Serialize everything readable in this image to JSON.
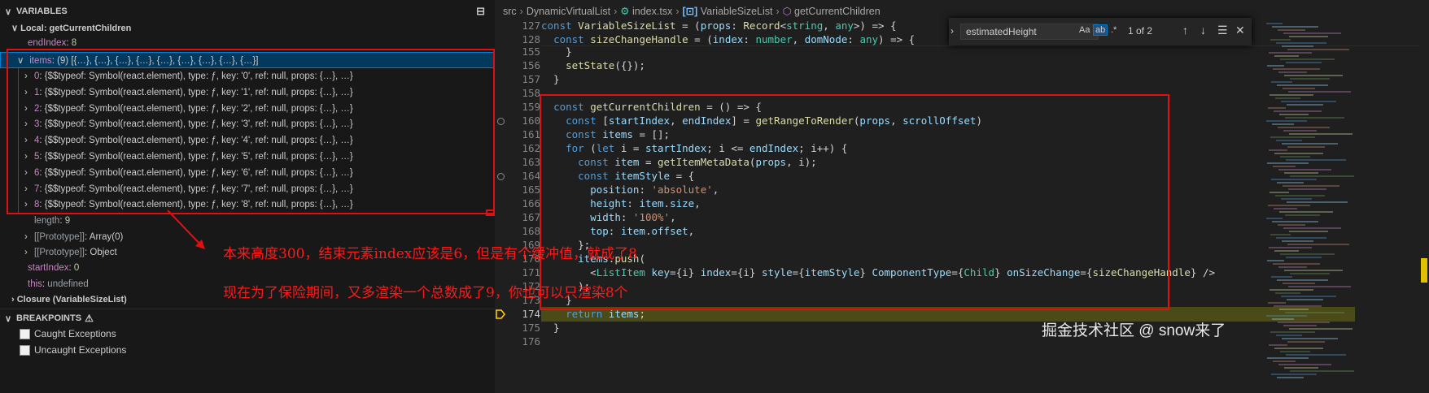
{
  "variables": {
    "header": "VARIABLES",
    "local_scope": "Local: getCurrentChildren",
    "end_index": {
      "name": "endIndex",
      "value": "8"
    },
    "items": {
      "name": "items",
      "summary": "(9) [{…}, {…}, {…}, {…}, {…}, {…}, {…}, {…}, {…}]",
      "children": [
        {
          "key": "0",
          "value": "{$$typeof: Symbol(react.element), type: ƒ, key: '0', ref: null, props: {…}, …}"
        },
        {
          "key": "1",
          "value": "{$$typeof: Symbol(react.element), type: ƒ, key: '1', ref: null, props: {…}, …}"
        },
        {
          "key": "2",
          "value": "{$$typeof: Symbol(react.element), type: ƒ, key: '2', ref: null, props: {…}, …}"
        },
        {
          "key": "3",
          "value": "{$$typeof: Symbol(react.element), type: ƒ, key: '3', ref: null, props: {…}, …}"
        },
        {
          "key": "4",
          "value": "{$$typeof: Symbol(react.element), type: ƒ, key: '4', ref: null, props: {…}, …}"
        },
        {
          "key": "5",
          "value": "{$$typeof: Symbol(react.element), type: ƒ, key: '5', ref: null, props: {…}, …}"
        },
        {
          "key": "6",
          "value": "{$$typeof: Symbol(react.element), type: ƒ, key: '6', ref: null, props: {…}, …}"
        },
        {
          "key": "7",
          "value": "{$$typeof: Symbol(react.element), type: ƒ, key: '7', ref: null, props: {…}, …}"
        },
        {
          "key": "8",
          "value": "{$$typeof: Symbol(react.element), type: ƒ, key: '8', ref: null, props: {…}, …}"
        }
      ],
      "length": {
        "name": "length",
        "value": "9"
      },
      "prototype1": {
        "name": "[[Prototype]]",
        "value": "Array(0)"
      },
      "prototype2": {
        "name": "[[Prototype]]",
        "value": "Object"
      }
    },
    "start_index": {
      "name": "startIndex",
      "value": "0"
    },
    "this_var": {
      "name": "this",
      "value": "undefined"
    },
    "closure_scope": "Closure (VariableSizeList)"
  },
  "breakpoints": {
    "header": "BREAKPOINTS",
    "warning_icon": "warning-icon",
    "items": [
      "Caught Exceptions",
      "Uncaught Exceptions"
    ]
  },
  "annotations": {
    "line1": "本来高度300，结束元素index应该是6，但是有个缓冲值，就成了8",
    "line2": "现在为了保险期间，又多渲染一个总数成了9，你也可以只渲染8个",
    "accent": "#e01010"
  },
  "breadcrumb": {
    "folder1": "src",
    "folder2": "DynamicVirtualList",
    "file": "index.tsx",
    "symbol1": "VariableSizeList",
    "symbol2": "getCurrentChildren"
  },
  "find": {
    "query": "estimatedHeight",
    "opt_case": "Aa",
    "opt_word": "ab",
    "opt_regex": ".*",
    "count": "1 of 2"
  },
  "line_numbers": [
    "127",
    "128",
    "155",
    "156",
    "157",
    "158",
    "159",
    "160",
    "161",
    "162",
    "163",
    "164",
    "165",
    "166",
    "167",
    "168",
    "169",
    "170",
    "171",
    "172",
    "173",
    "174",
    "175",
    "176"
  ],
  "code_lines": [
    "const VariableSizeList = (props: Record<string, any>) => {",
    "  const sizeChangeHandle = (index: number, domNode: any) => {",
    "    }",
    "    setState({});",
    "  }",
    "",
    "  const getCurrentChildren = () => {",
    "    const [startIndex, endIndex] = getRangeToRender(props, scrollOffset)",
    "    const items = [];",
    "    for (let i = startIndex; i <= endIndex; i++) {",
    "      const item = getItemMetaData(props, i);",
    "      const itemStyle = {",
    "        position: 'absolute',",
    "        height: item.size,",
    "        width: '100%',",
    "        top: item.offset,",
    "      };",
    "      items.push(",
    "        <ListItem key={i} index={i} style={itemStyle} ComponentType={Child} onSizeChange={sizeChangeHandle} />",
    "      );",
    "    }",
    "    return items;",
    "  }",
    ""
  ],
  "current_line": "174",
  "watermark": "掘金技术社区 @ snow来了"
}
